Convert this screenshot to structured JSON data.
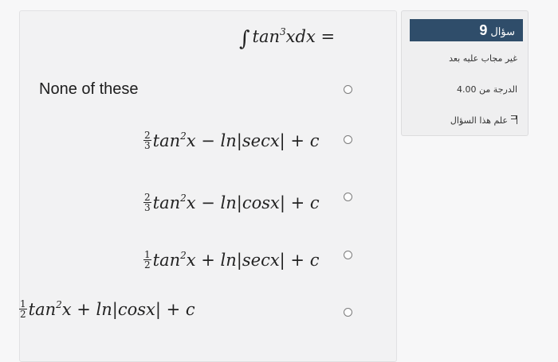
{
  "question": {
    "integral_sign": "∫",
    "stem_pre": "tan",
    "stem_exp": "3",
    "stem_post": "xdx ="
  },
  "options": [
    {
      "type": "text",
      "text": "None of these"
    },
    {
      "type": "math",
      "num": "2",
      "den": "3",
      "pre": "tan",
      "exp": "2",
      "post": "x − ln|secx| + c"
    },
    {
      "type": "math",
      "num": "2",
      "den": "3",
      "pre": "tan",
      "exp": "2",
      "post": "x − ln|cosx| + c"
    },
    {
      "type": "math",
      "num": "1",
      "den": "2",
      "pre": "tan",
      "exp": "2",
      "post": "x + ln|secx| + c"
    },
    {
      "type": "math",
      "num": "1",
      "den": "2",
      "pre": "tan",
      "exp": "2",
      "post": "x + ln|cosx| + c"
    }
  ],
  "info": {
    "question_word": "سؤال",
    "question_number": "9",
    "status": "غير مجاب عليه بعد",
    "marks": "الدرجة من 4.00",
    "flag_label": "علم هذا السؤال",
    "flag_icon": "flag-icon"
  },
  "colors": {
    "badge_bg": "#2f4d6a",
    "panel_bg": "#f2f2f3"
  }
}
